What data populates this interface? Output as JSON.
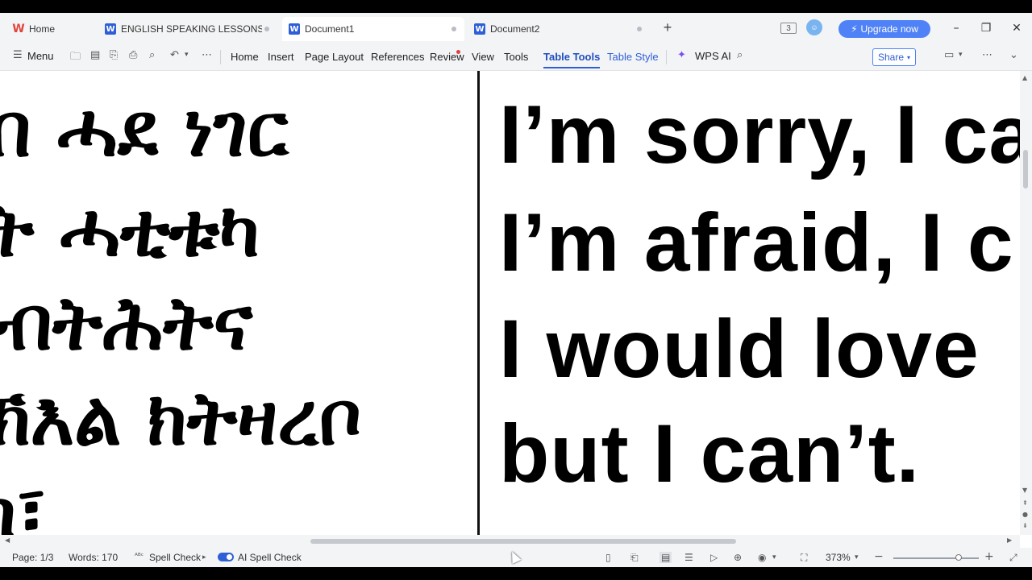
{
  "tabs": [
    {
      "label": "Home",
      "icon": "wps-logo-icon"
    },
    {
      "label": "ENGLISH  SPEAKING LESSONS.docx",
      "icon": "word-doc-icon"
    },
    {
      "label": "Document1",
      "icon": "word-doc-icon",
      "active": true
    },
    {
      "label": "Document2",
      "icon": "word-doc-icon"
    }
  ],
  "titlebar": {
    "upgrade_label": "Upgrade now",
    "window_badge": "3"
  },
  "menu": {
    "menu_label": "Menu",
    "items": [
      "Home",
      "Insert",
      "Page Layout",
      "References",
      "Review",
      "View",
      "Tools",
      "Table Tools",
      "Table Style"
    ],
    "active_item": "Table Tools",
    "wps_ai_label": "WPS AI",
    "share_label": "Share"
  },
  "document": {
    "left_column_lines": [
      "በ ሓደ ነገር",
      "ት ሓቲቱካ",
      "ብትሕትና",
      "ኽእል ክትዛረቦ",
      "ስ፣"
    ],
    "right_column_lines": [
      "I’m sorry, I ca",
      "I’m afraid, I c",
      "I would love",
      "but I can’t."
    ]
  },
  "statusbar": {
    "page": "Page: 1/3",
    "words": "Words: 170",
    "spell_check": "Spell Check",
    "ai_spell_check": "AI Spell Check",
    "zoom": "373%"
  },
  "colors": {
    "accent": "#2f5fd6",
    "upgrade_bg": "#4f82f7",
    "chrome_bg": "#f3f4f6"
  }
}
